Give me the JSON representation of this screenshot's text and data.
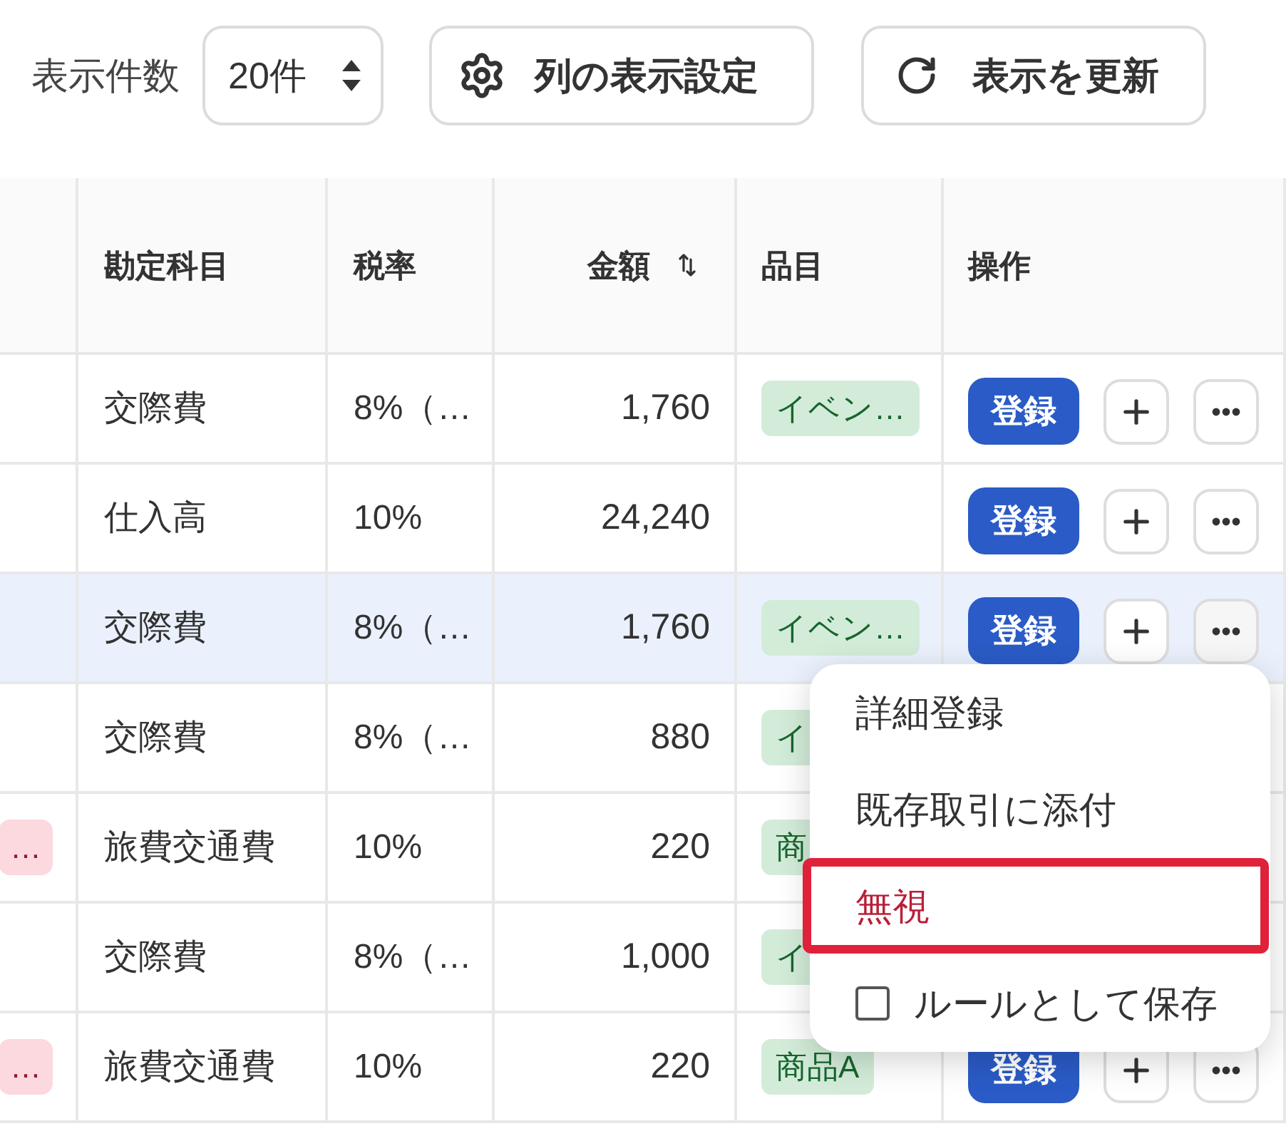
{
  "toolbar": {
    "page_size": {
      "label": "表示件数",
      "value": "20件"
    },
    "buttons": [
      {
        "kind": "columns",
        "label": "列の表示設定"
      },
      {
        "kind": "refresh",
        "label": "表示を更新"
      }
    ]
  },
  "table": {
    "columns": [
      {
        "kind": "account",
        "label": "勘定科目",
        "sortable": false
      },
      {
        "kind": "tax_rate",
        "label": "税率",
        "sortable": false
      },
      {
        "kind": "amount",
        "label": "金額",
        "sortable": true
      },
      {
        "kind": "item",
        "label": "品目",
        "sortable": false
      },
      {
        "kind": "actions",
        "label": "操作",
        "sortable": false
      }
    ],
    "rows": [
      {
        "selected": false,
        "account": "交際費",
        "tax_rate": "8%（…",
        "amount": "1,760",
        "item": "イベン…",
        "register_label": "登録"
      },
      {
        "selected": false,
        "account": "仕入高",
        "tax_rate": "10%",
        "amount": "24,240",
        "register_label": "登録"
      },
      {
        "selected": true,
        "account": "交際費",
        "tax_rate": "8%（…",
        "amount": "1,760",
        "item": "イベン…",
        "register_label": "登録"
      },
      {
        "selected": false,
        "account": "交際費",
        "tax_rate": "8%（…",
        "amount": "880",
        "item": "イ"
      },
      {
        "selected": false,
        "tag": "…",
        "account": "旅費交通費",
        "tax_rate": "10%",
        "amount": "220",
        "item": "商"
      },
      {
        "selected": false,
        "account": "交際費",
        "tax_rate": "8%（…",
        "amount": "1,000",
        "item": "イ"
      },
      {
        "selected": false,
        "tag": "…",
        "account": "旅費交通費",
        "tax_rate": "10%",
        "amount": "220",
        "item": "商品A",
        "register_label": "登録"
      }
    ]
  },
  "menu": {
    "items": [
      {
        "kind": "action",
        "label": "詳細登録",
        "highlighted": false
      },
      {
        "kind": "action",
        "label": "既存取引に添付",
        "highlighted": false
      },
      {
        "kind": "danger",
        "label": "無視",
        "highlighted": true
      },
      {
        "kind": "checkbox",
        "label": "ルールとして保存",
        "checked": false,
        "highlighted": false
      }
    ]
  }
}
